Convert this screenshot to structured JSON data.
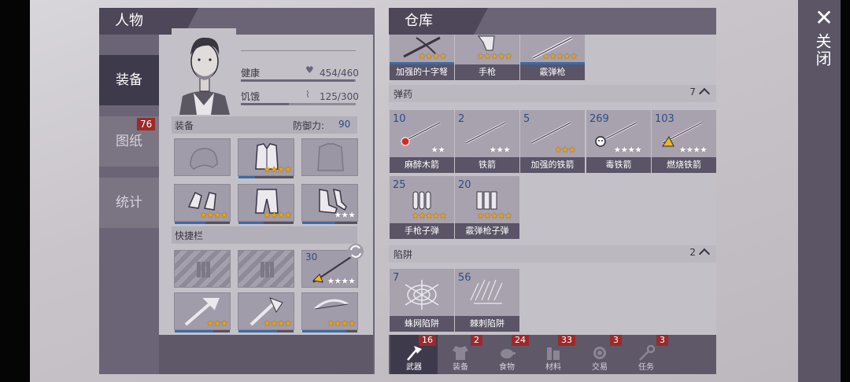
{
  "close": {
    "icon": "close-icon",
    "label": "关闭"
  },
  "character": {
    "title": "人物",
    "tabs": [
      {
        "label": "装备",
        "active": true
      },
      {
        "label": "图纸",
        "badge": "76"
      },
      {
        "label": "统计"
      }
    ],
    "stats": {
      "health_label": "健康",
      "health_value": "454/460",
      "health_fraction": 0.987,
      "hunger_label": "饥饿",
      "hunger_value": "125/300",
      "hunger_fraction": 0.417
    },
    "equipment_label": "装备",
    "defense_label": "防御力:",
    "defense_value": "90",
    "quickbar_label": "快捷栏",
    "quickbar_qty": "30",
    "equipment_slots": [
      {
        "icon": "helmet-icon",
        "stars": 0,
        "white_stars": 0
      },
      {
        "icon": "armor-vest-icon",
        "stars": 4,
        "white_stars": 0
      },
      {
        "icon": "jacket-icon",
        "stars": 0,
        "white_stars": 0
      },
      {
        "icon": "gloves-icon",
        "stars": 4,
        "white_stars": 0
      },
      {
        "icon": "pants-icon",
        "stars": 4,
        "white_stars": 0
      },
      {
        "icon": "boots-icon",
        "stars": 0,
        "white_stars": 3
      }
    ]
  },
  "warehouse": {
    "title": "仓库",
    "weapons_row": [
      {
        "name": "加强的十字弩",
        "icon": "crossbow-icon",
        "stars": 4
      },
      {
        "name": "手枪",
        "icon": "pistol-icon",
        "stars": 5
      },
      {
        "name": "霰弹枪",
        "icon": "shotgun-icon",
        "stars": 5
      }
    ],
    "ammo": {
      "label": "弹药",
      "count": "7",
      "items": [
        {
          "qty": "10",
          "name": "麻醉木箭",
          "icon": "tranq-arrow-icon",
          "stars": 0,
          "white_stars": 2
        },
        {
          "qty": "2",
          "name": "铁箭",
          "icon": "iron-arrow-icon",
          "stars": 0,
          "white_stars": 3
        },
        {
          "qty": "5",
          "name": "加强的铁箭",
          "icon": "reinforced-arrow-icon",
          "stars": 3,
          "white_stars": 0
        },
        {
          "qty": "269",
          "name": "毒铁箭",
          "icon": "poison-arrow-icon",
          "stars": 0,
          "white_stars": 4
        },
        {
          "qty": "103",
          "name": "燃烧铁箭",
          "icon": "fire-arrow-icon",
          "stars": 0,
          "white_stars": 4
        },
        {
          "qty": "25",
          "name": "手枪子弹",
          "icon": "pistol-ammo-icon",
          "stars": 5,
          "white_stars": 0
        },
        {
          "qty": "20",
          "name": "霰弹枪子弹",
          "icon": "shotgun-shell-icon",
          "stars": 5,
          "white_stars": 0
        }
      ]
    },
    "traps": {
      "label": "陷阱",
      "count": "2",
      "items": [
        {
          "qty": "7",
          "name": "蛛网陷阱",
          "icon": "web-trap-icon"
        },
        {
          "qty": "56",
          "name": "棘刺陷阱",
          "icon": "spike-trap-icon"
        }
      ]
    },
    "bottom_tabs": [
      {
        "label": "武器",
        "badge": "16",
        "icon": "axe-icon",
        "active": true
      },
      {
        "label": "装备",
        "badge": "2",
        "icon": "shirt-icon"
      },
      {
        "label": "食物",
        "badge": "24",
        "icon": "meat-icon"
      },
      {
        "label": "材料",
        "badge": "33",
        "icon": "materials-icon"
      },
      {
        "label": "交易",
        "badge": "3",
        "icon": "coin-icon"
      },
      {
        "label": "任务",
        "badge": "3",
        "icon": "key-icon"
      }
    ]
  },
  "colors": {
    "panel_dark": "#4e4759",
    "panel_mid": "#6a6476",
    "panel_light": "#c4c0c7",
    "star_gold": "#e8a21b",
    "badge_red": "#9c2a2a",
    "bar_blue": "#3d6aa6"
  }
}
